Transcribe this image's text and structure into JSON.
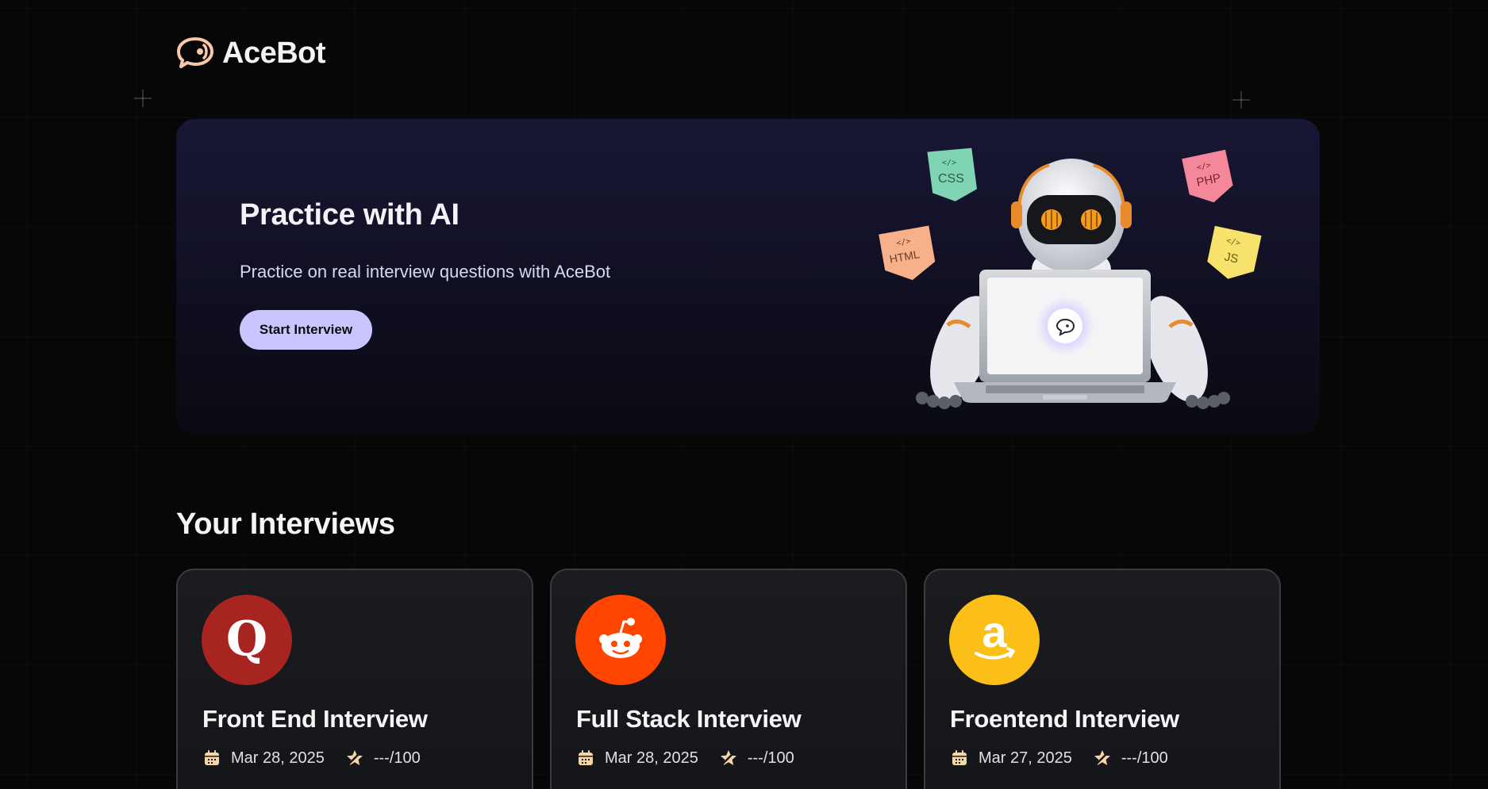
{
  "brand": {
    "name": "AceBot"
  },
  "hero": {
    "title": "Practice with AI",
    "subtitle": "Practice on real interview questions with AceBot",
    "cta_label": "Start Interview",
    "badges": [
      "CSS",
      "PHP",
      "HTML",
      "JS"
    ]
  },
  "interviews": {
    "section_title": "Your Interviews",
    "cards": [
      {
        "company": "Quora",
        "logo_letter": "Q",
        "logo_color": "#a82421",
        "title": "Front End Interview",
        "date": "Mar 28, 2025",
        "score": "---/100"
      },
      {
        "company": "Reddit",
        "logo_letter": "",
        "logo_color": "#ff4500",
        "title": "Full Stack Interview",
        "date": "Mar 28, 2025",
        "score": "---/100"
      },
      {
        "company": "Amazon",
        "logo_letter": "a",
        "logo_color": "#fcbf18",
        "title": "Froentend Interview",
        "date": "Mar 27, 2025",
        "score": "---/100"
      }
    ]
  },
  "colors": {
    "accent": "#cac5fe",
    "background": "#070707",
    "hero_bg": "#181734",
    "logo_icon": "#f8c8a8"
  }
}
